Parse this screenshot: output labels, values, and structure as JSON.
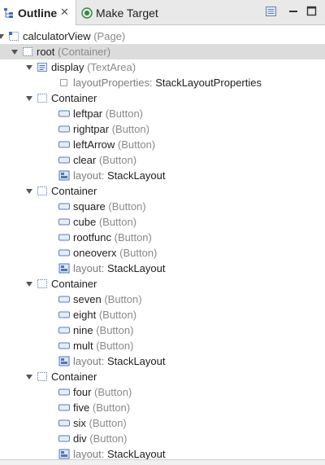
{
  "tabs": [
    {
      "label": "Outline",
      "active": true,
      "icon": "outline-icon"
    },
    {
      "label": "Make Target",
      "active": false,
      "icon": "make-target-icon"
    }
  ],
  "toolbar": {
    "icons": [
      "view-menu-icon",
      "minimize-icon",
      "maximize-icon"
    ]
  },
  "tree": [
    {
      "depth": 0,
      "arrow": "down",
      "icon": "page",
      "name": "calculatorView",
      "kind": "(Page)"
    },
    {
      "depth": 1,
      "arrow": "down",
      "icon": "container",
      "name": "root",
      "kind": "(Container)",
      "selected": true
    },
    {
      "depth": 2,
      "arrow": "down",
      "icon": "textarea",
      "name": "display",
      "kind": "(TextArea)"
    },
    {
      "depth": 3,
      "arrow": "none",
      "icon": "property",
      "name": "layoutProperties:",
      "value": "StackLayoutProperties"
    },
    {
      "depth": 2,
      "arrow": "down",
      "icon": "container",
      "name": "Container",
      "kind": ""
    },
    {
      "depth": 3,
      "arrow": "none",
      "icon": "button",
      "name": "leftpar",
      "kind": "(Button)"
    },
    {
      "depth": 3,
      "arrow": "none",
      "icon": "button",
      "name": "rightpar",
      "kind": "(Button)"
    },
    {
      "depth": 3,
      "arrow": "none",
      "icon": "button",
      "name": "leftArrow",
      "kind": "(Button)"
    },
    {
      "depth": 3,
      "arrow": "none",
      "icon": "button",
      "name": "clear",
      "kind": "(Button)"
    },
    {
      "depth": 3,
      "arrow": "none",
      "icon": "layout",
      "name": "layout:",
      "value": "StackLayout"
    },
    {
      "depth": 2,
      "arrow": "down",
      "icon": "container",
      "name": "Container",
      "kind": ""
    },
    {
      "depth": 3,
      "arrow": "none",
      "icon": "button",
      "name": "square",
      "kind": "(Button)"
    },
    {
      "depth": 3,
      "arrow": "none",
      "icon": "button",
      "name": "cube",
      "kind": "(Button)"
    },
    {
      "depth": 3,
      "arrow": "none",
      "icon": "button",
      "name": "rootfunc",
      "kind": "(Button)"
    },
    {
      "depth": 3,
      "arrow": "none",
      "icon": "button",
      "name": "oneoverx",
      "kind": "(Button)"
    },
    {
      "depth": 3,
      "arrow": "none",
      "icon": "layout",
      "name": "layout:",
      "value": "StackLayout"
    },
    {
      "depth": 2,
      "arrow": "down",
      "icon": "container",
      "name": "Container",
      "kind": ""
    },
    {
      "depth": 3,
      "arrow": "none",
      "icon": "button",
      "name": "seven",
      "kind": "(Button)"
    },
    {
      "depth": 3,
      "arrow": "none",
      "icon": "button",
      "name": "eight",
      "kind": "(Button)"
    },
    {
      "depth": 3,
      "arrow": "none",
      "icon": "button",
      "name": "nine",
      "kind": "(Button)"
    },
    {
      "depth": 3,
      "arrow": "none",
      "icon": "button",
      "name": "mult",
      "kind": "(Button)"
    },
    {
      "depth": 3,
      "arrow": "none",
      "icon": "layout",
      "name": "layout:",
      "value": "StackLayout"
    },
    {
      "depth": 2,
      "arrow": "down",
      "icon": "container",
      "name": "Container",
      "kind": ""
    },
    {
      "depth": 3,
      "arrow": "none",
      "icon": "button",
      "name": "four",
      "kind": "(Button)"
    },
    {
      "depth": 3,
      "arrow": "none",
      "icon": "button",
      "name": "five",
      "kind": "(Button)"
    },
    {
      "depth": 3,
      "arrow": "none",
      "icon": "button",
      "name": "six",
      "kind": "(Button)"
    },
    {
      "depth": 3,
      "arrow": "none",
      "icon": "button",
      "name": "div",
      "kind": "(Button)"
    },
    {
      "depth": 3,
      "arrow": "none",
      "icon": "layout",
      "name": "layout:",
      "value": "StackLayout"
    }
  ],
  "colors": {
    "selection": "#dcdcdc",
    "kind_text": "#8a8a8a",
    "icon_blue": "#3f6fb5"
  }
}
